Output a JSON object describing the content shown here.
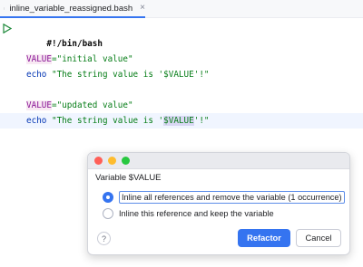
{
  "tab": {
    "title": "inline_variable_reassigned.bash",
    "icon": "bash-file-icon",
    "close_glyph": "×"
  },
  "editor": {
    "lines": {
      "l1": {
        "text": "#!/bin/bash"
      },
      "l3": {
        "var": "VALUE",
        "rest": "=\"initial value\""
      },
      "l4": {
        "cmd": "echo",
        "before": " \"The string value is '",
        "ref": "$VALUE",
        "after": "'!\""
      },
      "l6": {
        "var": "VALUE",
        "rest": "=\"updated value\""
      },
      "l7": {
        "cmd": "echo",
        "before": " \"The string value is '",
        "ref": "$VALUE",
        "after": "'!\""
      }
    }
  },
  "dialog": {
    "title": "Variable $VALUE",
    "options": [
      {
        "label": "Inline all references and remove the variable (1 occurrence)",
        "selected": true
      },
      {
        "label": "Inline this reference and keep the variable",
        "selected": false
      }
    ],
    "help_glyph": "?",
    "refactor_label": "Refactor",
    "cancel_label": "Cancel"
  },
  "colors": {
    "accent": "#3574f0",
    "string": "#067d17",
    "keyword": "#0033b3",
    "variable": "#871094"
  }
}
